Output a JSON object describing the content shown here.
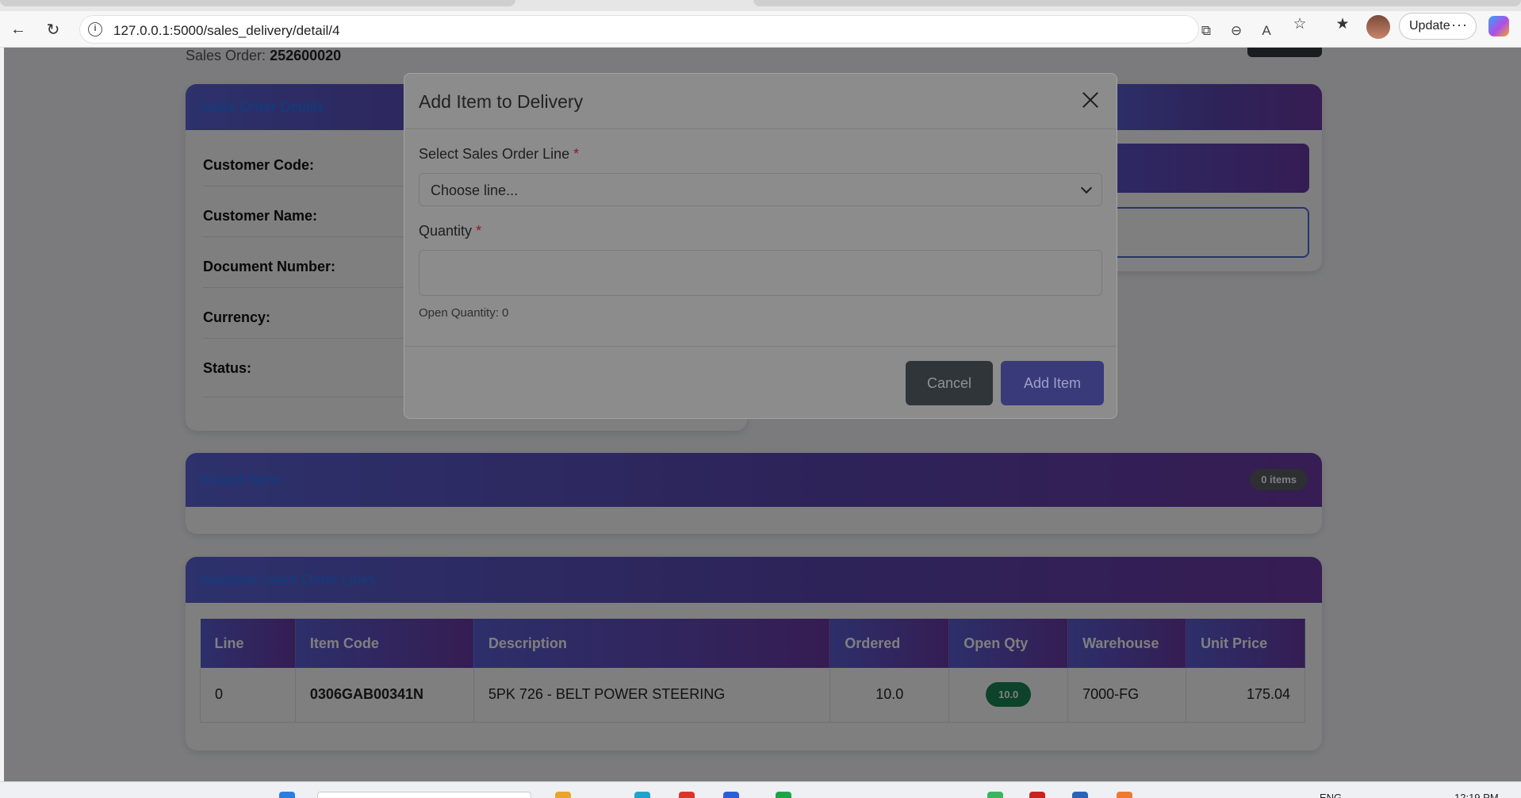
{
  "browser": {
    "url": "127.0.0.1:5000/sales_delivery/detail/4",
    "update_label": "Update",
    "more_label": "···",
    "icons": [
      "back-icon",
      "reload-icon",
      "site-info-icon",
      "open-in-app-icon",
      "zoom-out-icon",
      "read-aloud-icon",
      "favorite-star-icon",
      "favorites-icon",
      "profile-avatar",
      "copilot-icon"
    ]
  },
  "page": {
    "sales_order_label": "Sales Order:",
    "sales_order_number": "252600020"
  },
  "details": {
    "header": "Sales Order Details",
    "rows": [
      {
        "label": "Customer Code:"
      },
      {
        "label": "Customer Name:"
      },
      {
        "label": "Document Number:"
      },
      {
        "label": "Currency:"
      },
      {
        "label": "Status:"
      }
    ]
  },
  "picked": {
    "header": "Picked Items",
    "badge": "0 items"
  },
  "available": {
    "header": "Available Sales Order Lines",
    "columns": [
      "Line",
      "Item Code",
      "Description",
      "Ordered",
      "Open Qty",
      "Warehouse",
      "Unit Price"
    ],
    "rows": [
      {
        "line": "0",
        "item_code": "0306GAB00341N",
        "description": "5PK 726 - BELT POWER STEERING",
        "ordered": "10.0",
        "open_qty": "10.0",
        "warehouse": "7000-FG",
        "unit_price": "175.04"
      }
    ]
  },
  "modal": {
    "title": "Add Item to Delivery",
    "select_label": "Select Sales Order Line",
    "select_value": "Choose line...",
    "quantity_label": "Quantity",
    "required_mark": "*",
    "quantity_value": "",
    "help_text": "Open Quantity: 0",
    "cancel_label": "Cancel",
    "add_label": "Add Item"
  },
  "taskbar": {
    "lang": "ENG",
    "time": "12:19 PM"
  },
  "colors": {
    "header_gradient_start": "#5a63d8",
    "header_gradient_end": "#6d3aa6",
    "header_text": "#1f7bff",
    "badge_green": "#198754",
    "cancel_button": "#343a40",
    "add_button": "#4a4db5"
  }
}
